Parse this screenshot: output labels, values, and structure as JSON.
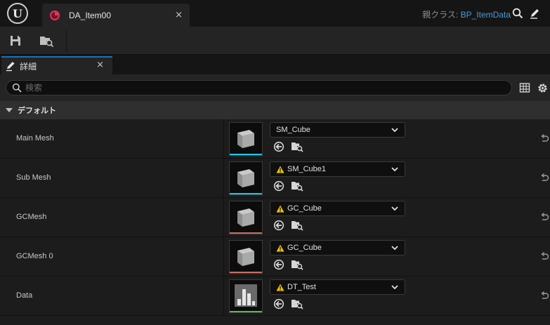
{
  "window": {
    "tab_title": "DA_Item00",
    "tab_close": "×",
    "parent_class_label": "親クラス:",
    "parent_class_value": "BP_ItemData",
    "logo_text": "U"
  },
  "toolbar": {
    "buttons": [
      "save-icon",
      "browse-asset-icon"
    ]
  },
  "details_panel": {
    "tab_label": "詳細",
    "tab_close": "×",
    "search_placeholder": "検索",
    "category_label": "デフォルト"
  },
  "properties": [
    {
      "name": "Main Mesh",
      "asset": "SM_Cube",
      "warning": false,
      "thumbnail": "cube",
      "accent": "#1bc8e8"
    },
    {
      "name": "Sub Mesh",
      "asset": "SM_Cube1",
      "warning": true,
      "thumbnail": "cube",
      "accent": "#1bc8e8"
    },
    {
      "name": "GCMesh",
      "asset": "GC_Cube",
      "warning": true,
      "thumbnail": "cube",
      "accent": "#c87060"
    },
    {
      "name": "GCMesh 0",
      "asset": "GC_Cube",
      "warning": true,
      "thumbnail": "cube",
      "accent": "#c87060"
    },
    {
      "name": "Data",
      "asset": "DT_Test",
      "warning": true,
      "thumbnail": "datatable",
      "accent": "#4cc24c"
    }
  ],
  "colors": {
    "accent_blue": "#1f6fb8",
    "link_blue": "#4a9bd8",
    "warning_yellow": "#f2c200",
    "asset_icon": "#e0345a"
  }
}
